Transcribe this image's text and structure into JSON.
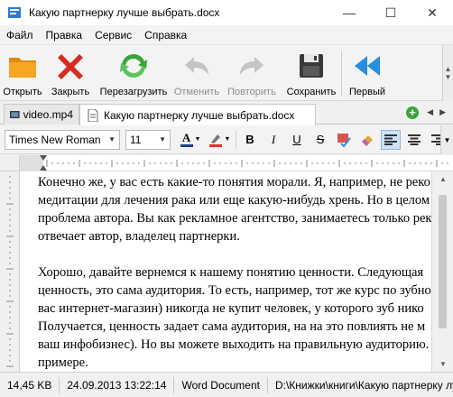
{
  "window": {
    "title": "Какую партнерку лучше выбрать.docx",
    "minimize": "—",
    "maximize": "☐",
    "close": "✕"
  },
  "menu": [
    "Файл",
    "Правка",
    "Сервис",
    "Справка"
  ],
  "toolbar": {
    "open": "Открыть",
    "close": "Закрыть",
    "reload": "Перезагрузить",
    "undo": "Отменить",
    "redo": "Повторить",
    "save": "Сохранить",
    "first": "Первый"
  },
  "tabs": [
    {
      "label": "video.mp4",
      "active": false
    },
    {
      "label": "Какую партнерку лучше выбрать.docx",
      "active": true
    }
  ],
  "format": {
    "font": "Times New Roman",
    "size": "11",
    "bold": "B",
    "italic": "I",
    "underline": "U",
    "strike": "S",
    "text_color_letter": "A",
    "font_color": "#1f3c8c",
    "highlight_color": "#e8332a"
  },
  "document": {
    "lines": [
      "Конечно же, у вас есть какие-то понятия морали. Я, например, не реко",
      "медитации для лечения рака или еще какую-нибудь хрень. Но в целом",
      "проблема автора. Вы как рекламное агентство, занимаетесь только рек",
      "отвечает автор, владелец партнерки.",
      "",
      "Хорошо, давайте вернемся к нашему понятию ценности. Следующая",
      "ценность, это сама аудитория. То есть, например, тот же курс по зубно",
      "вас интернет-магазин) никогда не купит человек, у которого зуб нико",
      "Получается, ценность задает сама аудитория, на на это повлиять не м",
      "ваш инфобизнес). Но вы можете выходить на правильную аудиторию.",
      "примере."
    ]
  },
  "status": {
    "size": "14,45 KB",
    "date": "24.09.2013 13:22:14",
    "type": "Word Document",
    "path": "D:\\Книжки\\книги\\Какую партнерку лу"
  }
}
